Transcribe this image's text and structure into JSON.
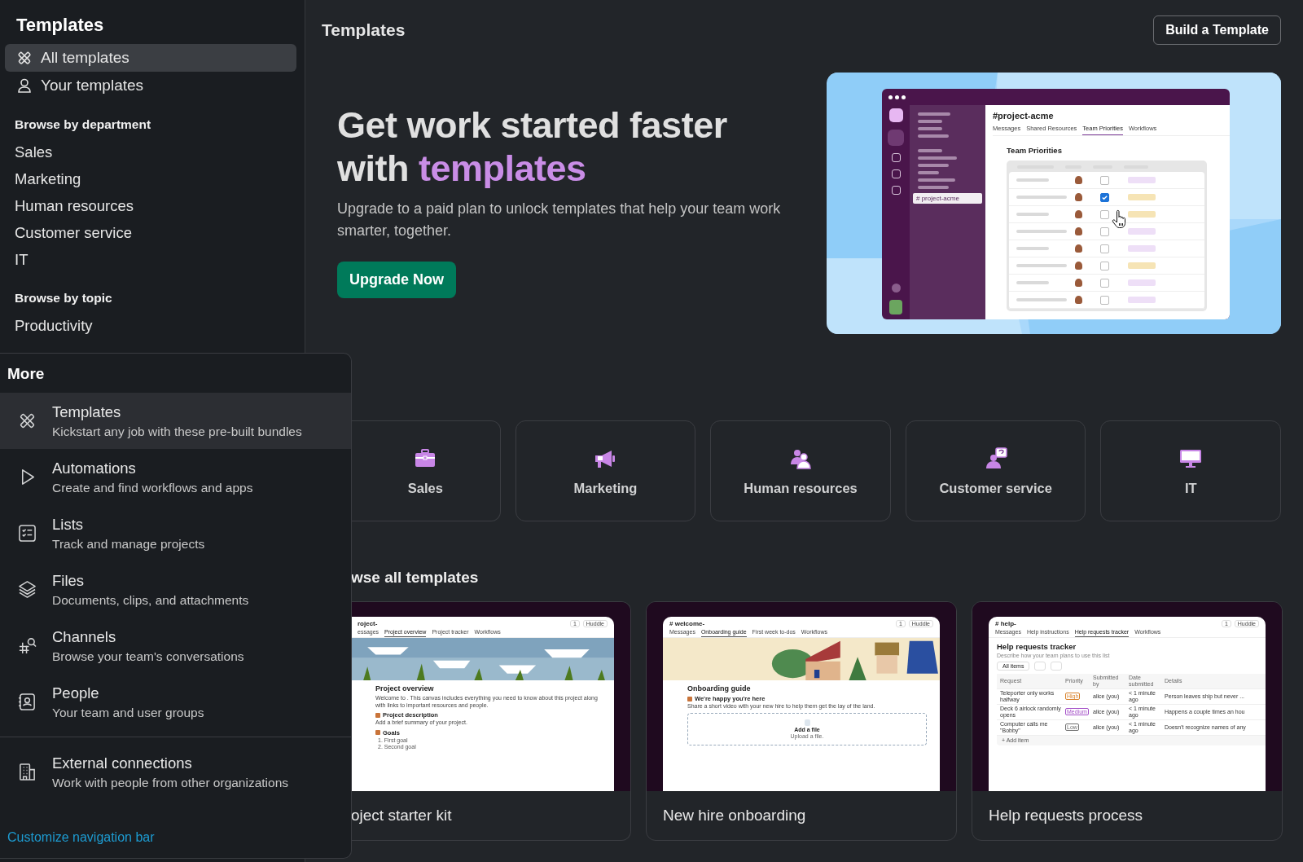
{
  "sidebar": {
    "title": "Templates",
    "nav": [
      {
        "label": "All templates",
        "kind": "templates",
        "selected": true
      },
      {
        "label": "Your templates",
        "kind": "person",
        "selected": false
      }
    ],
    "sections": [
      {
        "heading": "Browse by department",
        "items": [
          "Sales",
          "Marketing",
          "Human resources",
          "Customer service",
          "IT"
        ]
      },
      {
        "heading": "Browse by topic",
        "items": [
          "Productivity"
        ]
      }
    ]
  },
  "header": {
    "title": "Templates",
    "button": "Build a Template"
  },
  "hero": {
    "title_line_1": "Get work started faster",
    "title_line_2": "with",
    "highlight": "templates",
    "text": "Upgrade to a paid plan to unlock templates that help your team work smarter, together.",
    "button": "Upgrade Now",
    "illustration": {
      "sidebar_item": "# project-acme",
      "channel": "#project-acme",
      "tabs": [
        {
          "label": "Messages",
          "selected": false
        },
        {
          "label": "Shared Resources",
          "selected": false
        },
        {
          "label": "Team Priorities",
          "selected": true
        },
        {
          "label": "Workflows",
          "selected": false
        }
      ],
      "heading": "Team Priorities",
      "rows": [
        {
          "checked": false,
          "color": "#eedff7"
        },
        {
          "checked": true,
          "color": "#f6e4b5"
        },
        {
          "checked": false,
          "color": "#f6e4b5"
        },
        {
          "checked": false,
          "color": "#eedff7"
        },
        {
          "checked": false,
          "color": "#eedff7"
        },
        {
          "checked": false,
          "color": "#f6e4b5"
        },
        {
          "checked": false,
          "color": "#eedff7"
        },
        {
          "checked": false,
          "color": "#eedff7"
        }
      ]
    }
  },
  "departments": [
    {
      "label": "Sales",
      "kind": "briefcase"
    },
    {
      "label": "Marketing",
      "kind": "megaphone"
    },
    {
      "label": "Human resources",
      "kind": "people"
    },
    {
      "label": "Customer service",
      "kind": "support"
    },
    {
      "label": "IT",
      "kind": "monitor"
    }
  ],
  "browse_heading": "wse all templates",
  "templates": [
    {
      "title": "oject starter kit",
      "preview": {
        "kind": "canvas",
        "channel": "roject-",
        "count": "1",
        "huddle": "Huddle",
        "tabs": [
          {
            "label": "essages",
            "selected": false
          },
          {
            "label": "Project overview",
            "selected": true
          },
          {
            "label": "Project tracker",
            "selected": false
          },
          {
            "label": "Workflows",
            "selected": false
          }
        ],
        "heading": "Project overview",
        "blocks": [
          {
            "kind": "text",
            "text": "Welcome to . This canvas includes everything you need to know about this project along with links to important resources and people."
          },
          {
            "kind": "subheading",
            "text": "Project description"
          },
          {
            "kind": "text",
            "text": "Add a brief summary of your project."
          },
          {
            "kind": "subheading",
            "text": "Goals"
          },
          {
            "kind": "item",
            "text": "1.  First goal"
          },
          {
            "kind": "item",
            "text": "2.  Second goal"
          }
        ]
      }
    },
    {
      "title": "New hire onboarding",
      "preview": {
        "kind": "canvas",
        "channel": "# welcome-",
        "count": "1",
        "huddle": "Huddle",
        "tabs": [
          {
            "label": "Messages",
            "selected": false
          },
          {
            "label": "Onboarding guide",
            "selected": true
          },
          {
            "label": "First week to-dos",
            "selected": false
          },
          {
            "label": "Workflows",
            "selected": false
          }
        ],
        "heading": "Onboarding guide",
        "blocks": [
          {
            "kind": "subheading",
            "text": "We're happy you're here"
          },
          {
            "kind": "text",
            "text": "Share a short video with your new hire to help them get the lay of the land."
          },
          {
            "kind": "file",
            "text": "Add a file",
            "note": "Upload a file."
          }
        ]
      }
    },
    {
      "title": "Help requests process",
      "preview": {
        "kind": "list",
        "channel": "# help-",
        "count": "1",
        "huddle": "Huddle",
        "tabs": [
          {
            "label": "Messages",
            "selected": false
          },
          {
            "label": "Help instructions",
            "selected": false
          },
          {
            "label": "Help requests tracker",
            "selected": true
          },
          {
            "label": "Workflows",
            "selected": false
          }
        ],
        "heading": "Help requests tracker",
        "description": "Describe how your team plans to use this list",
        "filter": "All items",
        "columns": [
          "Request",
          "Priority",
          "Submitted by",
          "Date submitted",
          "Details"
        ],
        "rows": [
          {
            "request": "Teleporter only works halfway",
            "priority": "High",
            "color": "#d9822b",
            "by": "alice (you)",
            "date": "< 1 minute ago",
            "details": "Person leaves ship but never ..."
          },
          {
            "request": "Deck 6 airlock randomly opens",
            "priority": "Medium",
            "color": "#a450c8",
            "by": "alice (you)",
            "date": "< 1 minute ago",
            "details": "Happens a couple times an hou"
          },
          {
            "request": "Computer calls me \"Bobby\"",
            "priority": "Low",
            "color": "#707070",
            "by": "alice (you)",
            "date": "< 1 minute ago",
            "details": "Doesn't recognize names of any"
          }
        ],
        "add": "+ Add item"
      }
    }
  ],
  "more_menu": {
    "title": "More",
    "groups": [
      [
        {
          "kind": "templates",
          "title": "Templates",
          "subtitle": "Kickstart any job with these pre-built bundles",
          "selected": true
        },
        {
          "kind": "play",
          "title": "Automations",
          "subtitle": "Create and find workflows and apps",
          "selected": false
        },
        {
          "kind": "list",
          "title": "Lists",
          "subtitle": "Track and manage projects",
          "selected": false
        },
        {
          "kind": "layers",
          "title": "Files",
          "subtitle": "Documents, clips, and attachments",
          "selected": false
        },
        {
          "kind": "channels",
          "title": "Channels",
          "subtitle": "Browse your team's conversations",
          "selected": false
        },
        {
          "kind": "contact",
          "title": "People",
          "subtitle": "Your team and user groups",
          "selected": false
        }
      ],
      [
        {
          "kind": "building",
          "title": "External connections",
          "subtitle": "Work with people from other organizations",
          "selected": false
        }
      ]
    ],
    "link": "Customize navigation bar"
  }
}
